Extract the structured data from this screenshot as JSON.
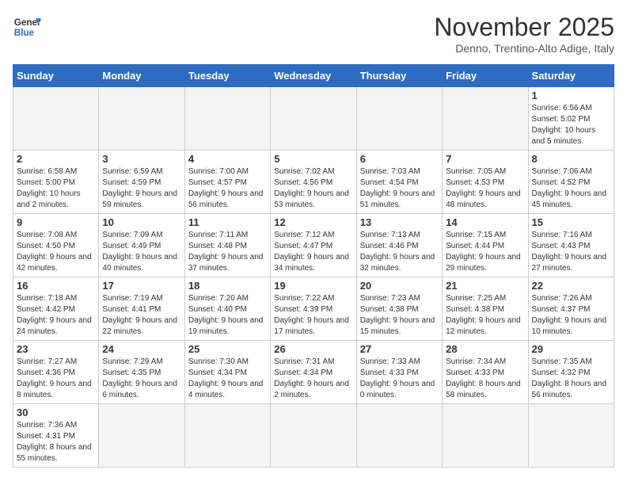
{
  "header": {
    "logo_general": "General",
    "logo_blue": "Blue",
    "month_title": "November 2025",
    "subtitle": "Denno, Trentino-Alto Adige, Italy"
  },
  "weekdays": [
    "Sunday",
    "Monday",
    "Tuesday",
    "Wednesday",
    "Thursday",
    "Friday",
    "Saturday"
  ],
  "weeks": [
    [
      {
        "day": "",
        "info": ""
      },
      {
        "day": "",
        "info": ""
      },
      {
        "day": "",
        "info": ""
      },
      {
        "day": "",
        "info": ""
      },
      {
        "day": "",
        "info": ""
      },
      {
        "day": "",
        "info": ""
      },
      {
        "day": "1",
        "info": "Sunrise: 6:56 AM\nSunset: 5:02 PM\nDaylight: 10 hours and 5 minutes."
      }
    ],
    [
      {
        "day": "2",
        "info": "Sunrise: 6:58 AM\nSunset: 5:00 PM\nDaylight: 10 hours and 2 minutes."
      },
      {
        "day": "3",
        "info": "Sunrise: 6:59 AM\nSunset: 4:59 PM\nDaylight: 9 hours and 59 minutes."
      },
      {
        "day": "4",
        "info": "Sunrise: 7:00 AM\nSunset: 4:57 PM\nDaylight: 9 hours and 56 minutes."
      },
      {
        "day": "5",
        "info": "Sunrise: 7:02 AM\nSunset: 4:56 PM\nDaylight: 9 hours and 53 minutes."
      },
      {
        "day": "6",
        "info": "Sunrise: 7:03 AM\nSunset: 4:54 PM\nDaylight: 9 hours and 51 minutes."
      },
      {
        "day": "7",
        "info": "Sunrise: 7:05 AM\nSunset: 4:53 PM\nDaylight: 9 hours and 48 minutes."
      },
      {
        "day": "8",
        "info": "Sunrise: 7:06 AM\nSunset: 4:52 PM\nDaylight: 9 hours and 45 minutes."
      }
    ],
    [
      {
        "day": "9",
        "info": "Sunrise: 7:08 AM\nSunset: 4:50 PM\nDaylight: 9 hours and 42 minutes."
      },
      {
        "day": "10",
        "info": "Sunrise: 7:09 AM\nSunset: 4:49 PM\nDaylight: 9 hours and 40 minutes."
      },
      {
        "day": "11",
        "info": "Sunrise: 7:11 AM\nSunset: 4:48 PM\nDaylight: 9 hours and 37 minutes."
      },
      {
        "day": "12",
        "info": "Sunrise: 7:12 AM\nSunset: 4:47 PM\nDaylight: 9 hours and 34 minutes."
      },
      {
        "day": "13",
        "info": "Sunrise: 7:13 AM\nSunset: 4:46 PM\nDaylight: 9 hours and 32 minutes."
      },
      {
        "day": "14",
        "info": "Sunrise: 7:15 AM\nSunset: 4:44 PM\nDaylight: 9 hours and 29 minutes."
      },
      {
        "day": "15",
        "info": "Sunrise: 7:16 AM\nSunset: 4:43 PM\nDaylight: 9 hours and 27 minutes."
      }
    ],
    [
      {
        "day": "16",
        "info": "Sunrise: 7:18 AM\nSunset: 4:42 PM\nDaylight: 9 hours and 24 minutes."
      },
      {
        "day": "17",
        "info": "Sunrise: 7:19 AM\nSunset: 4:41 PM\nDaylight: 9 hours and 22 minutes."
      },
      {
        "day": "18",
        "info": "Sunrise: 7:20 AM\nSunset: 4:40 PM\nDaylight: 9 hours and 19 minutes."
      },
      {
        "day": "19",
        "info": "Sunrise: 7:22 AM\nSunset: 4:39 PM\nDaylight: 9 hours and 17 minutes."
      },
      {
        "day": "20",
        "info": "Sunrise: 7:23 AM\nSunset: 4:38 PM\nDaylight: 9 hours and 15 minutes."
      },
      {
        "day": "21",
        "info": "Sunrise: 7:25 AM\nSunset: 4:38 PM\nDaylight: 9 hours and 12 minutes."
      },
      {
        "day": "22",
        "info": "Sunrise: 7:26 AM\nSunset: 4:37 PM\nDaylight: 9 hours and 10 minutes."
      }
    ],
    [
      {
        "day": "23",
        "info": "Sunrise: 7:27 AM\nSunset: 4:36 PM\nDaylight: 9 hours and 8 minutes."
      },
      {
        "day": "24",
        "info": "Sunrise: 7:29 AM\nSunset: 4:35 PM\nDaylight: 9 hours and 6 minutes."
      },
      {
        "day": "25",
        "info": "Sunrise: 7:30 AM\nSunset: 4:34 PM\nDaylight: 9 hours and 4 minutes."
      },
      {
        "day": "26",
        "info": "Sunrise: 7:31 AM\nSunset: 4:34 PM\nDaylight: 9 hours and 2 minutes."
      },
      {
        "day": "27",
        "info": "Sunrise: 7:33 AM\nSunset: 4:33 PM\nDaylight: 9 hours and 0 minutes."
      },
      {
        "day": "28",
        "info": "Sunrise: 7:34 AM\nSunset: 4:33 PM\nDaylight: 8 hours and 58 minutes."
      },
      {
        "day": "29",
        "info": "Sunrise: 7:35 AM\nSunset: 4:32 PM\nDaylight: 8 hours and 56 minutes."
      }
    ],
    [
      {
        "day": "30",
        "info": "Sunrise: 7:36 AM\nSunset: 4:31 PM\nDaylight: 8 hours and 55 minutes."
      },
      {
        "day": "",
        "info": ""
      },
      {
        "day": "",
        "info": ""
      },
      {
        "day": "",
        "info": ""
      },
      {
        "day": "",
        "info": ""
      },
      {
        "day": "",
        "info": ""
      },
      {
        "day": "",
        "info": ""
      }
    ]
  ]
}
